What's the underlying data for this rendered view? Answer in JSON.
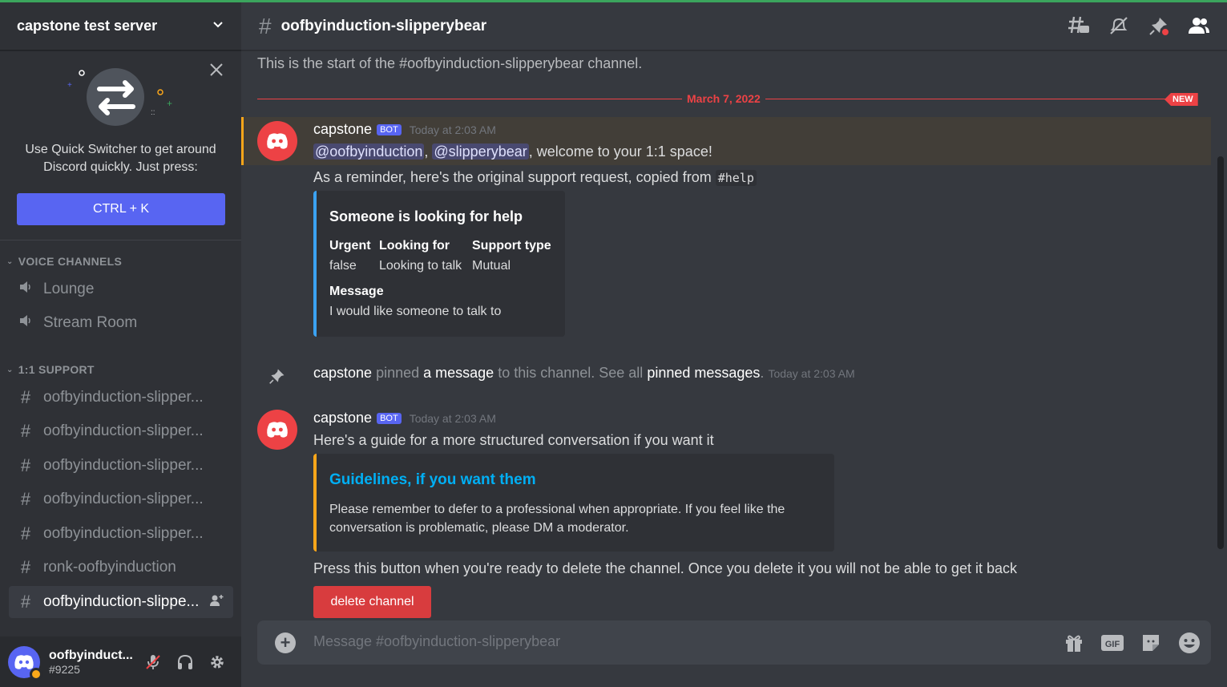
{
  "server": {
    "name": "capstone test server"
  },
  "quick_switcher": {
    "text_line1": "Use Quick Switcher to get around",
    "text_line2": "Discord quickly. Just press:",
    "shortcut": "CTRL + K"
  },
  "categories": {
    "voice": "VOICE CHANNELS",
    "support": "1:1 SUPPORT"
  },
  "voice_channels": [
    "Lounge",
    "Stream Room"
  ],
  "support_channels": [
    "oofbyinduction-slipper...",
    "oofbyinduction-slipper...",
    "oofbyinduction-slipper...",
    "oofbyinduction-slipper...",
    "oofbyinduction-slipper...",
    "ronk-oofbyinduction",
    "oofbyinduction-slippe..."
  ],
  "user": {
    "name": "oofbyinduct...",
    "tag": "#9225"
  },
  "channel": {
    "name": "oofbyinduction-slipperybear",
    "start_text": "This is the start of the #oofbyinduction-slipperybear channel."
  },
  "divider": {
    "date": "March 7, 2022",
    "new_label": "NEW"
  },
  "message1": {
    "author": "capstone",
    "bot_tag": "BOT",
    "timestamp": "Today at 2:03 AM",
    "mention1": "@oofbyinduction",
    "sep": ",",
    "mention2": "@slipperybear",
    "welcome": ", welcome to your 1:1 space!",
    "reminder": "As a reminder, here's the original support request, copied from",
    "reminder_code": "#help"
  },
  "embed1": {
    "title": "Someone is looking for help",
    "fields": [
      {
        "name": "Urgent",
        "value": "false"
      },
      {
        "name": "Looking for",
        "value": "Looking to talk"
      },
      {
        "name": "Support type",
        "value": "Mutual"
      }
    ],
    "message_name": "Message",
    "message_value": "I would like someone to talk to"
  },
  "pin_notice": {
    "author": "capstone",
    "t1": " pinned ",
    "t2": "a message",
    "t3": " to this channel. See all ",
    "t4": "pinned messages",
    "t5": ".",
    "timestamp": "Today at 2:03 AM"
  },
  "message2": {
    "author": "capstone",
    "bot_tag": "BOT",
    "timestamp": "Today at 2:03 AM",
    "text": "Here's a guide for a more structured conversation if you want it",
    "after_embed": "Press this button when you're ready to delete the channel. Once you delete it you will not be able to get it back",
    "button": "delete channel"
  },
  "embed2": {
    "title": "Guidelines, if you want them",
    "desc": "Please remember to defer to a professional when appropriate. If you feel like the conversation is problematic, please DM a moderator."
  },
  "composer": {
    "placeholder": "Message #oofbyinduction-slipperybear",
    "gif_label": "GIF"
  },
  "colors": {
    "blurple": "#5865f2",
    "danger": "#ed4245",
    "mention_highlight": "#faa61a",
    "link": "#00aff4",
    "online_status": "#faa81a"
  },
  "icons": [
    "chevron-down-icon",
    "close-icon",
    "speaker-icon",
    "hash-icon",
    "threads-icon",
    "mute-icon",
    "pin-icon",
    "members-icon",
    "mic-muted-icon",
    "headphones-icon",
    "gear-icon",
    "gift-icon",
    "gif-icon",
    "sticker-icon",
    "emoji-icon",
    "plus-icon",
    "add-member-icon"
  ]
}
